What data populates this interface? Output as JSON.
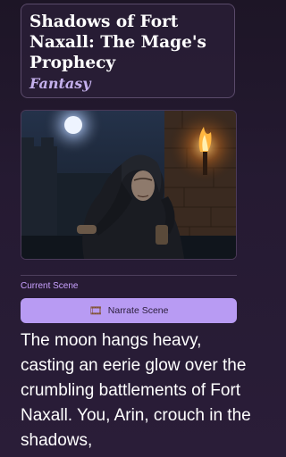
{
  "story": {
    "title": "Shadows of Fort Naxall: The Mage's Prophecy",
    "genre": "Fantasy"
  },
  "scene": {
    "section_label": "Current Scene",
    "narrate_label": "Narrate Scene",
    "narrate_icon": "film-icon",
    "text": "The moon hangs heavy, casting an eerie glow over the crumbling battlements of Fort Naxall. You, Arin, crouch in the shadows,"
  },
  "colors": {
    "accent": "#b89bf3",
    "label": "#c9a1ff",
    "genre": "#c4b0ec",
    "background": "#251a32"
  }
}
